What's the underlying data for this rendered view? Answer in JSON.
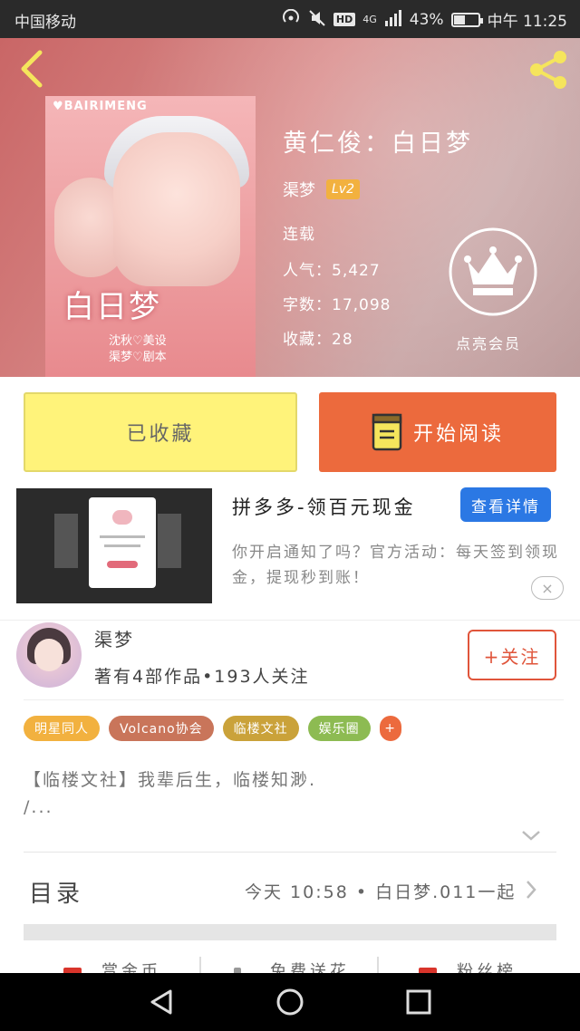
{
  "status_bar": {
    "carrier": "中国移动",
    "network": "4G",
    "hd": "HD",
    "battery": "43%",
    "battery_level": 0.43,
    "time": "中午 11:25"
  },
  "book": {
    "title": "黄仁俊：白日梦",
    "author": "渠梦",
    "level": "Lv2",
    "status": "连载",
    "popularity": "人气：5,427",
    "word_count": "字数：17,098",
    "collections": "收藏：28",
    "vip_label": "点亮会员",
    "cover": {
      "brand": "♥BAIRIMENG",
      "title_art": "白日梦",
      "credits_line1": "沈秋♡美设",
      "credits_line2": "渠梦♡剧本"
    }
  },
  "actions": {
    "favorited_label": "已收藏",
    "read_label": "开始阅读"
  },
  "ad": {
    "title": "拼多多-领百元现金",
    "detail_button": "查看详情",
    "description": "你开启通知了吗？官方活动：每天签到领现金，提现秒到账！",
    "close_icon": "×"
  },
  "author_info": {
    "name": "渠梦",
    "stats": "著有4部作品•193人关注",
    "follow_label": "+关注"
  },
  "tags": [
    {
      "label": "明星同人",
      "color": "#f2b13f"
    },
    {
      "label": "Volcano协会",
      "color": "#c9755a"
    },
    {
      "label": "临楼文社",
      "color": "#caa23a"
    },
    {
      "label": "娱乐圈",
      "color": "#8dbb52"
    },
    {
      "label": "+",
      "color": "#ec6a3d"
    }
  ],
  "intro": {
    "line1": "【临楼文社】我辈后生，临楼知渺.",
    "line2": "/..."
  },
  "toc": {
    "label": "目录",
    "latest": "今天 10:58 • 白日梦.011一起"
  },
  "bottom_tabs": [
    {
      "label": "赏金币",
      "icon_color": "#d9342b"
    },
    {
      "label": "免费送花",
      "icon_color": "#999999"
    },
    {
      "label": "粉丝榜",
      "icon_color": "#d9342b"
    }
  ]
}
